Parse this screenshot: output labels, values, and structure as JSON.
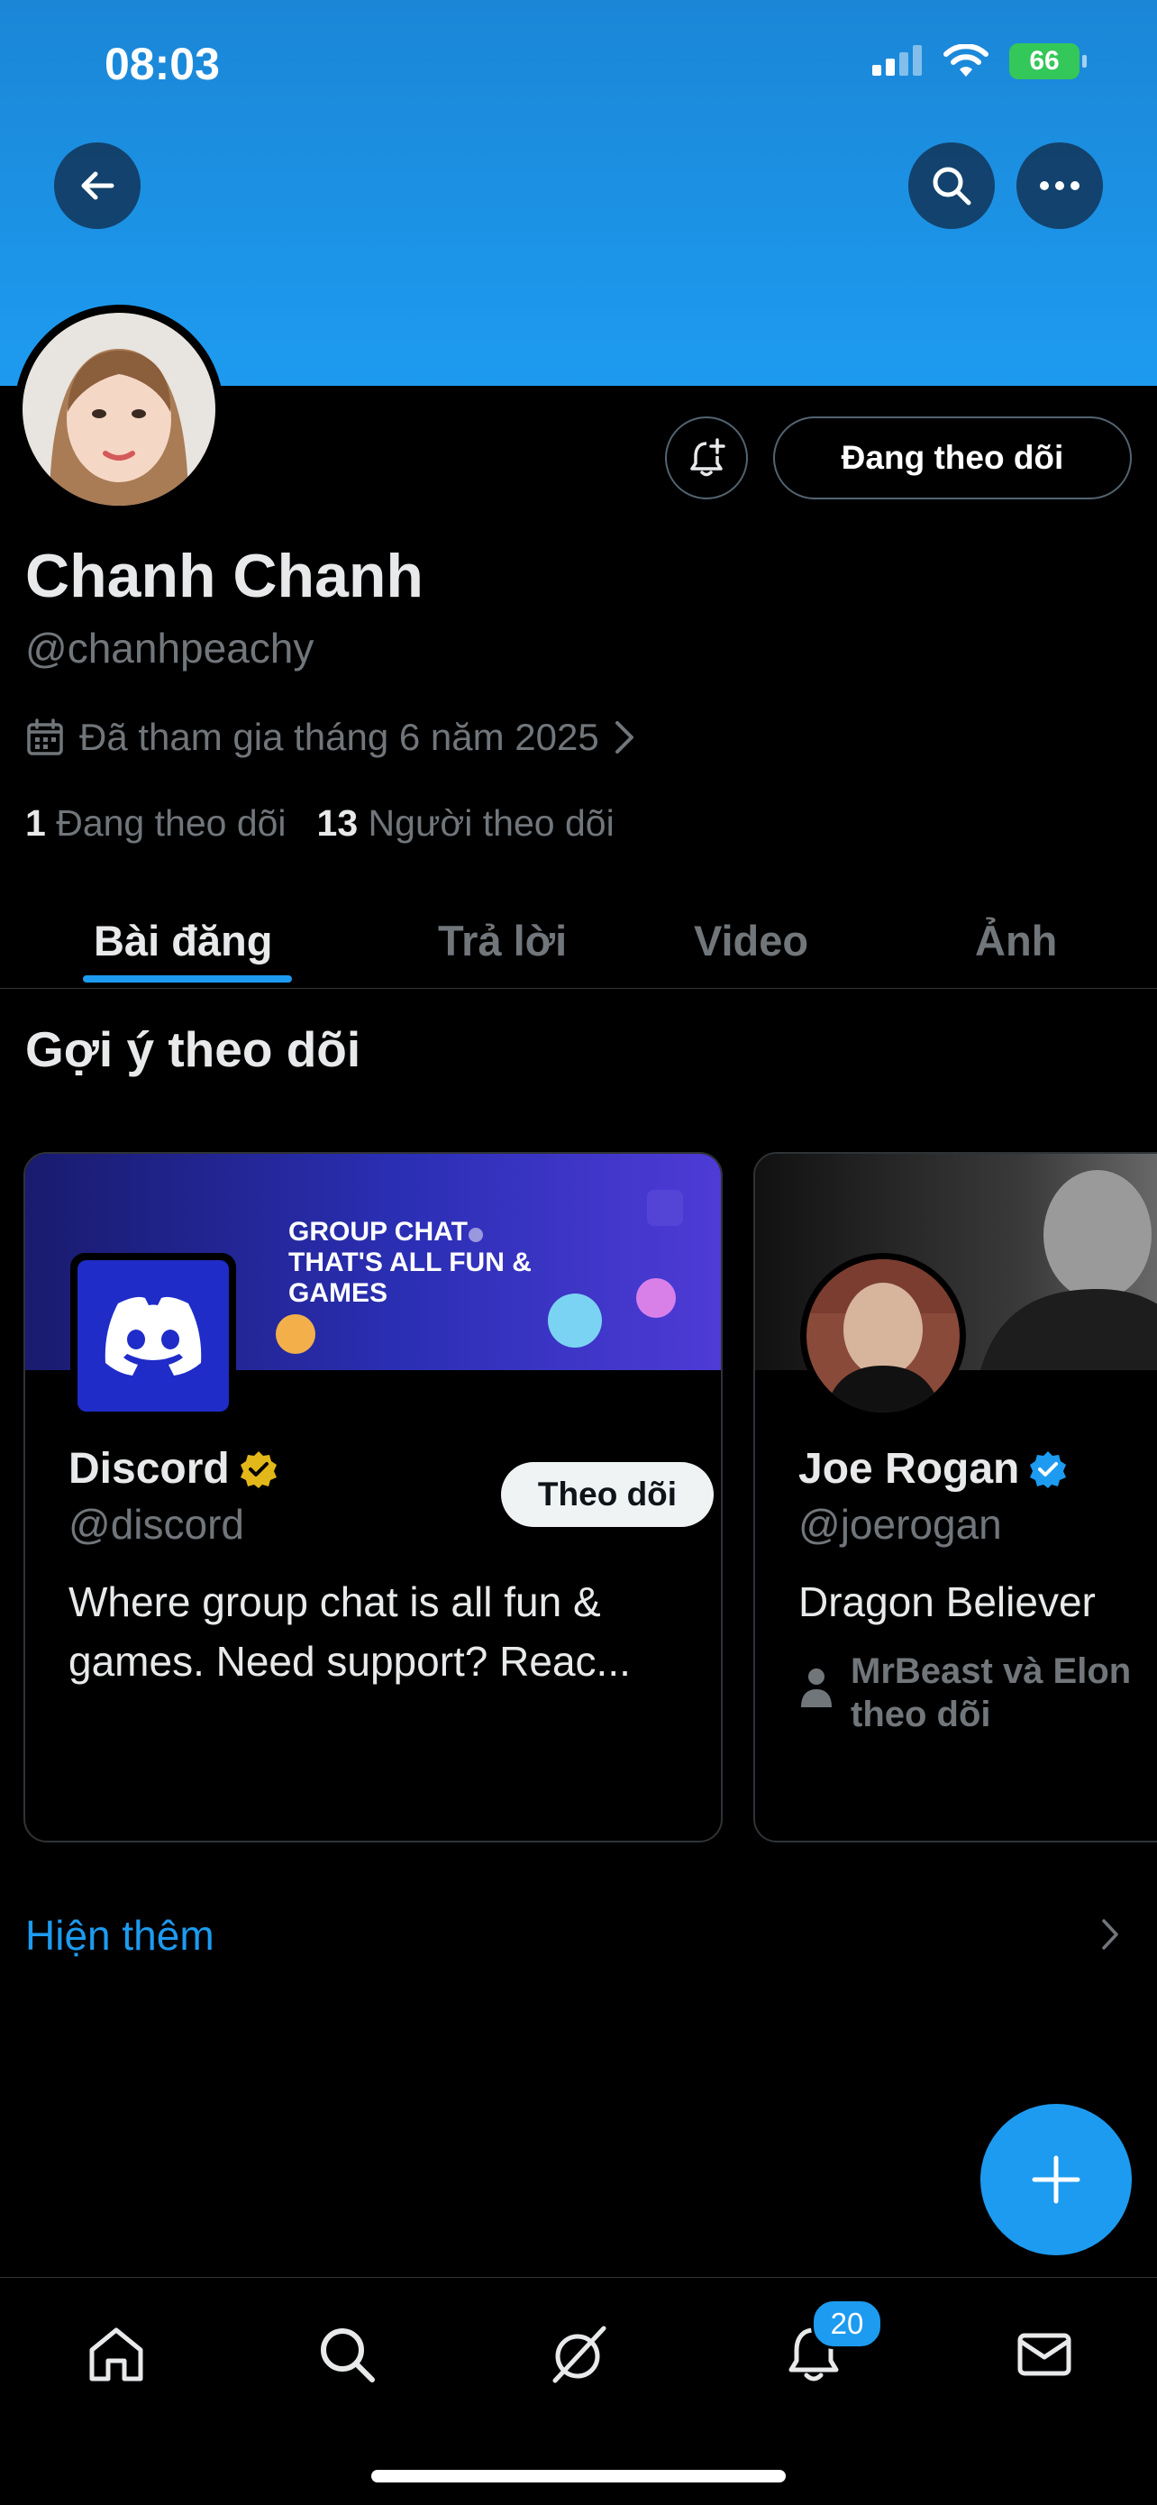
{
  "status_bar": {
    "time": "08:03",
    "battery": "66"
  },
  "profile": {
    "name": "Chanh Chanh",
    "handle": "@chanhpeachy",
    "joined": "Đã tham gia tháng 6 năm 2025",
    "following_count": "1",
    "following_label": "Đang theo dõi",
    "followers_count": "13",
    "followers_label": "Người theo dõi",
    "follow_state_button": "Đang theo dõi"
  },
  "tabs": [
    {
      "label": "Bài đăng",
      "active": true
    },
    {
      "label": "Trả lời",
      "active": false
    },
    {
      "label": "Video",
      "active": false
    },
    {
      "label": "Ảnh",
      "active": false
    }
  ],
  "suggestions": {
    "title": "Gợi ý theo dõi",
    "cards": [
      {
        "name": "Discord",
        "handle": "@discord",
        "bio_line1": "Where group chat is all fun &",
        "bio_line2": "games. Need support? Reac...",
        "banner_text": "GROUP CHAT THAT'S ALL FUN & GAMES",
        "follow_label": "Theo dõi",
        "verified_color": "#e2b719"
      },
      {
        "name": "Joe Rogan",
        "handle": "@joerogan",
        "bio_line1": "Dragon Believer",
        "social_line1": "MrBeast và Elon",
        "social_line2": "theo dõi",
        "verified_color": "#1d9bf0"
      }
    ],
    "show_more": "Hiện thêm"
  },
  "notifications_badge": "20",
  "colors": {
    "accent": "#1d9bf0",
    "background": "#000000",
    "secondary_text": "#71767b"
  }
}
